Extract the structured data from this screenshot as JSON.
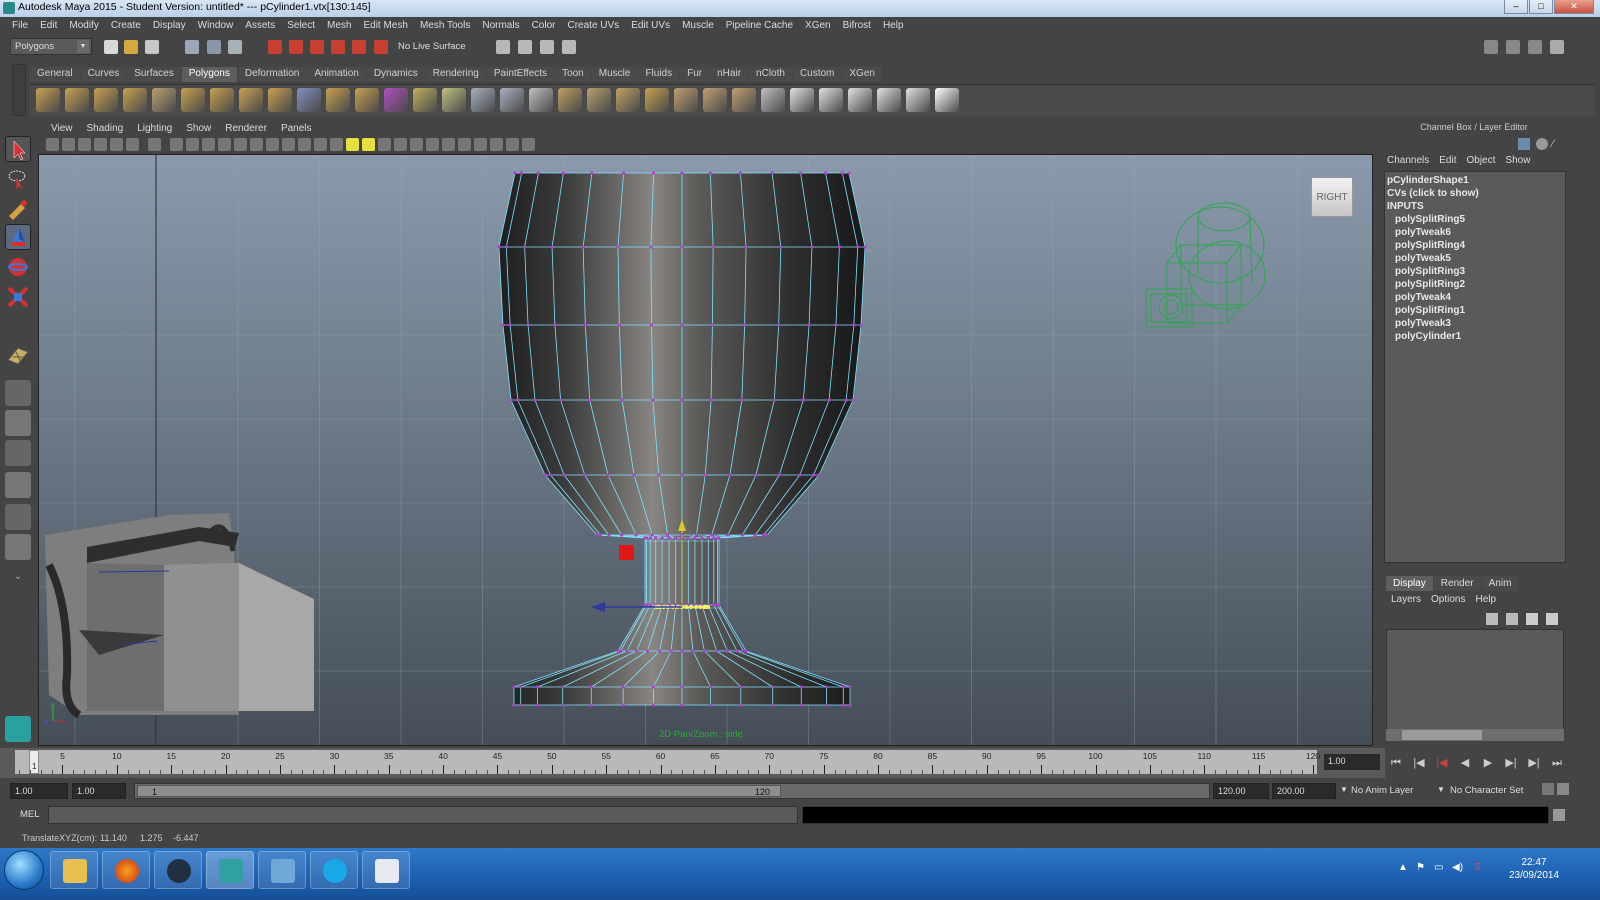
{
  "window": {
    "title": "Autodesk Maya 2015 - Student Version: untitled*   ---   pCylinder1.vtx[130:145]"
  },
  "menubar": [
    "File",
    "Edit",
    "Modify",
    "Create",
    "Display",
    "Window",
    "Assets",
    "Select",
    "Mesh",
    "Edit Mesh",
    "Mesh Tools",
    "Normals",
    "Color",
    "Create UVs",
    "Edit UVs",
    "Muscle",
    "Pipeline Cache",
    "XGen",
    "Bifrost",
    "Help"
  ],
  "statusline": {
    "mode": "Polygons",
    "live_surface": "No Live Surface"
  },
  "shelf": {
    "tabs": [
      "General",
      "Curves",
      "Surfaces",
      "Polygons",
      "Deformation",
      "Animation",
      "Dynamics",
      "Rendering",
      "PaintEffects",
      "Toon",
      "Muscle",
      "Fluids",
      "Fur",
      "nHair",
      "nCloth",
      "Custom",
      "XGen"
    ],
    "active_tab": "Polygons",
    "icon_colors": [
      "#c8a050",
      "#c8a050",
      "#c8a050",
      "#c8a050",
      "#b8a070",
      "#c8a050",
      "#c8a050",
      "#c8a050",
      "#c8a050",
      "#8090c0",
      "#c8a050",
      "#c8a050",
      "#b050c0",
      "#c0b060",
      "#c0c080",
      "#a8b0c0",
      "#a8b0c0",
      "#c0c0c0",
      "#c0a060",
      "#b8a070",
      "#c0a060",
      "#c8a050",
      "#c0a070",
      "#c0a070",
      "#c0a070",
      "#c0c0c0",
      "#e0e0e0",
      "#e0e0e0",
      "#e0e0e0",
      "#e0e0e0",
      "#e0e0e0",
      "#ffffff"
    ]
  },
  "viewport": {
    "menu": [
      "View",
      "Shading",
      "Lighting",
      "Show",
      "Renderer",
      "Panels"
    ],
    "view_cube_label": "RIGHT",
    "hud_text": "2D Pan/Zoom : side"
  },
  "timeline": {
    "labels": [
      "5",
      "10",
      "15",
      "20",
      "25",
      "30",
      "35",
      "40",
      "45",
      "50",
      "55",
      "60",
      "65",
      "70",
      "75",
      "80",
      "85",
      "90",
      "95",
      "100",
      "105",
      "110",
      "115",
      "120"
    ],
    "current_frame": "1",
    "current_time": "1.00"
  },
  "range": {
    "start_time": "1.00",
    "playback_start": "1.00",
    "range_start_label": "1",
    "range_end_label": "120",
    "playback_end": "120.00",
    "end_time": "200.00",
    "anim_layer": "No Anim Layer",
    "character_set": "No Character Set"
  },
  "command": {
    "label": "MEL"
  },
  "helpline": {
    "label": "TranslateXYZ(cm):",
    "x": "11.140",
    "y": "1.275",
    "z": "-6.447"
  },
  "channel_box": {
    "title": "Channel Box / Layer Editor",
    "menu": [
      "Channels",
      "Edit",
      "Object",
      "Show"
    ],
    "shape": "pCylinderShape1",
    "cvs": "CVs (click to show)",
    "inputs_header": "INPUTS",
    "inputs": [
      "polySplitRing5",
      "polyTweak6",
      "polySplitRing4",
      "polyTweak5",
      "polySplitRing3",
      "polySplitRing2",
      "polyTweak4",
      "polySplitRing1",
      "polyTweak3",
      "polyCylinder1"
    ]
  },
  "layer_editor": {
    "tabs": [
      "Display",
      "Render",
      "Anim"
    ],
    "active_tab": "Display",
    "menu": [
      "Layers",
      "Options",
      "Help"
    ]
  },
  "taskbar": {
    "time": "22:47",
    "date": "23/09/2014"
  },
  "colors": {
    "wire": "#7fe3ff",
    "vertex": "#b040d0",
    "selected_vertex": "#f5f560",
    "camera_wire": "#2aa84a"
  }
}
